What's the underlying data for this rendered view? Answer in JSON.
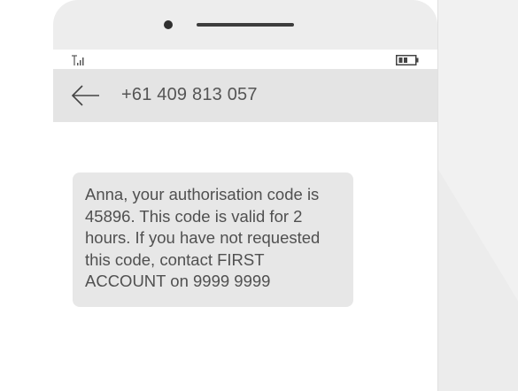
{
  "status_bar": {
    "signal_icon": "signal-strength-icon",
    "battery_icon": "battery-icon"
  },
  "header": {
    "back_icon": "arrow-left-icon",
    "phone_number": "+61 409 813 057"
  },
  "message": {
    "text": "Anna, your authorisation code is 45896. This code is valid for 2 hours. If you have not requested this code, contact FIRST ACCOUNT on 9999 9999"
  },
  "colors": {
    "bezel": "#ededed",
    "header": "#e4e4e4",
    "bubble": "#e7e7e7",
    "text": "#505050"
  }
}
